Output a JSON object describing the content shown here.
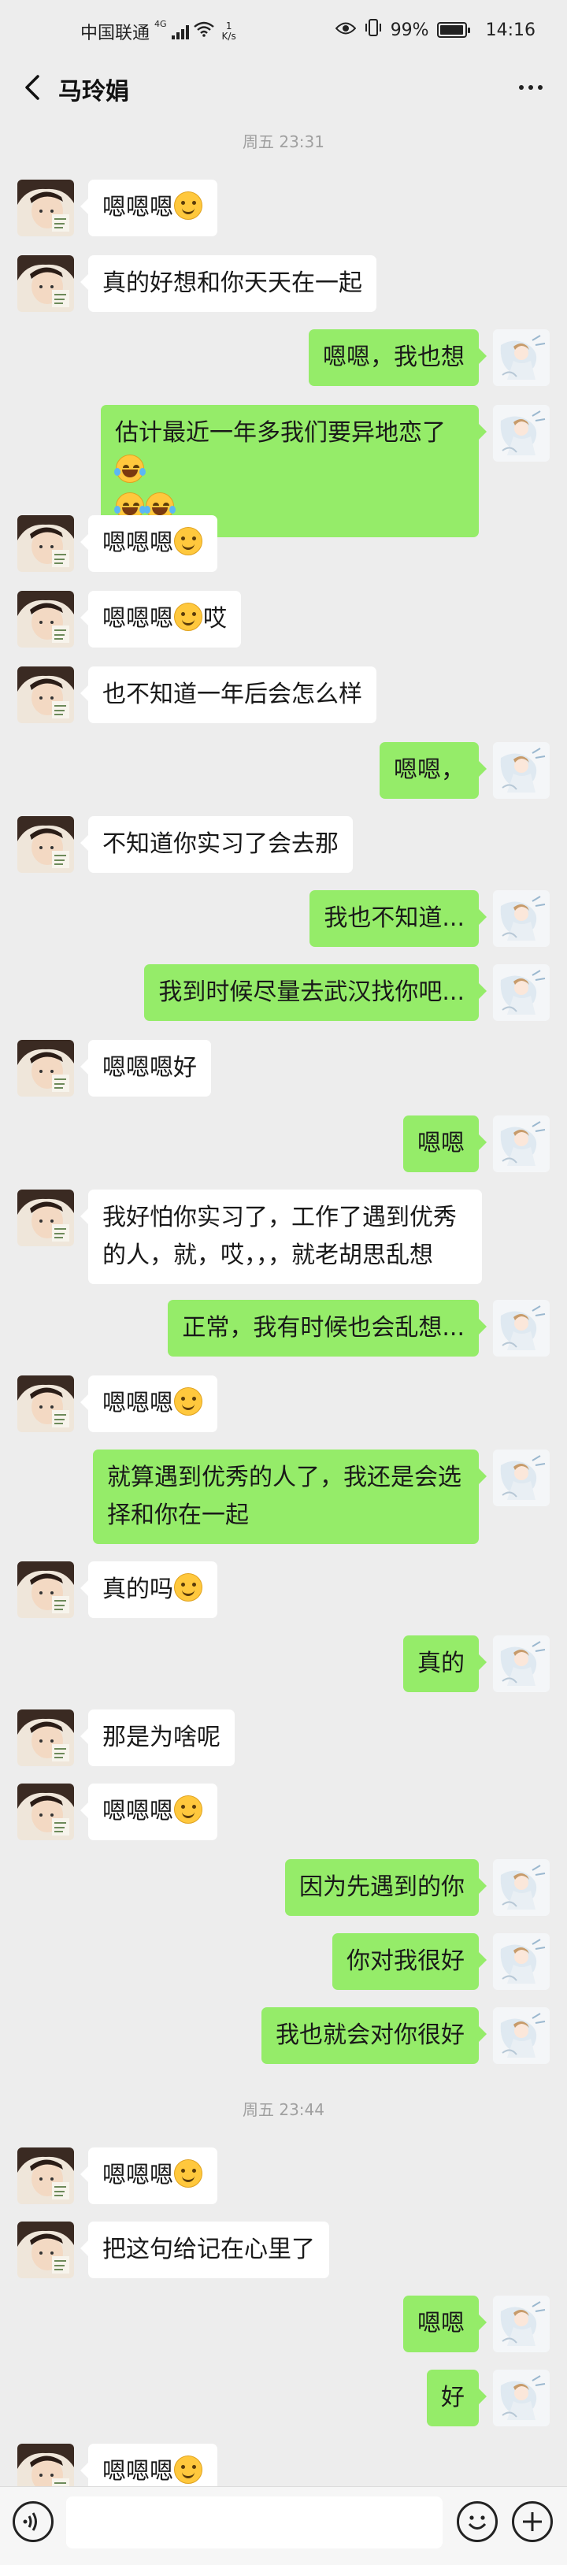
{
  "status_bar": {
    "carrier": "中国联通",
    "network_type": "4G",
    "net_speed_value": "1",
    "net_speed_unit": "K/s",
    "battery_percent": "99%",
    "battery_level": 0.99,
    "time": "14:16"
  },
  "header": {
    "title": "马玲娟"
  },
  "timestamps": [
    "周五 23:31",
    "周五 23:44"
  ],
  "messages": [
    {
      "side": "left",
      "text": "嗯嗯嗯",
      "emoji": "smile"
    },
    {
      "side": "left",
      "text": "真的好想和你天天在一起"
    },
    {
      "side": "right",
      "text": "嗯嗯，我也想"
    },
    {
      "side": "right",
      "text_1": "估计最近一年多我们要异地恋了",
      "text_2": "",
      "emoji": "tears-of-joy"
    },
    {
      "side": "left",
      "text": "嗯嗯嗯",
      "emoji": "smile"
    },
    {
      "side": "left",
      "text_1": "嗯嗯嗯",
      "text_2": "哎",
      "emoji": "smile"
    },
    {
      "side": "left",
      "text": "也不知道一年后会怎么样"
    },
    {
      "side": "right",
      "text": "嗯嗯，"
    },
    {
      "side": "left",
      "text": "不知道你实习了会去那"
    },
    {
      "side": "right",
      "text": "我也不知道..."
    },
    {
      "side": "right",
      "text": "我到时候尽量去武汉找你吧..."
    },
    {
      "side": "left",
      "text": "嗯嗯嗯好"
    },
    {
      "side": "right",
      "text": "嗯嗯"
    },
    {
      "side": "left",
      "text": "我好怕你实习了，工作了遇到优秀的人，就，哎，，，就老胡思乱想"
    },
    {
      "side": "right",
      "text": "正常，我有时候也会乱想..."
    },
    {
      "side": "left",
      "text": "嗯嗯嗯",
      "emoji": "smile"
    },
    {
      "side": "right",
      "text": "就算遇到优秀的人了，我还是会选择和你在一起"
    },
    {
      "side": "left",
      "text": "真的吗",
      "emoji": "smile"
    },
    {
      "side": "right",
      "text": "真的"
    },
    {
      "side": "left",
      "text": "那是为啥呢"
    },
    {
      "side": "left",
      "text": "嗯嗯嗯",
      "emoji": "smile"
    },
    {
      "side": "right",
      "text": "因为先遇到的你"
    },
    {
      "side": "right",
      "text": "你对我很好"
    },
    {
      "side": "right",
      "text": "我也就会对你很好"
    },
    {
      "side": "left",
      "text": "嗯嗯嗯",
      "emoji": "smile"
    },
    {
      "side": "left",
      "text": "把这句给记在心里了"
    },
    {
      "side": "right",
      "text": "嗯嗯"
    },
    {
      "side": "right",
      "text": "好"
    },
    {
      "side": "left",
      "text": "嗯嗯嗯",
      "emoji": "smile"
    }
  ],
  "icons": {
    "back": "chevron-left-icon",
    "more": "more-dots-icon",
    "voice": "voice-icon",
    "emoji": "emoji-icon",
    "plus": "plus-icon"
  },
  "colors": {
    "background": "#ededed",
    "sent_bubble": "#95ec69",
    "received_bubble": "#ffffff",
    "timestamp_text": "#a0a0a0"
  }
}
